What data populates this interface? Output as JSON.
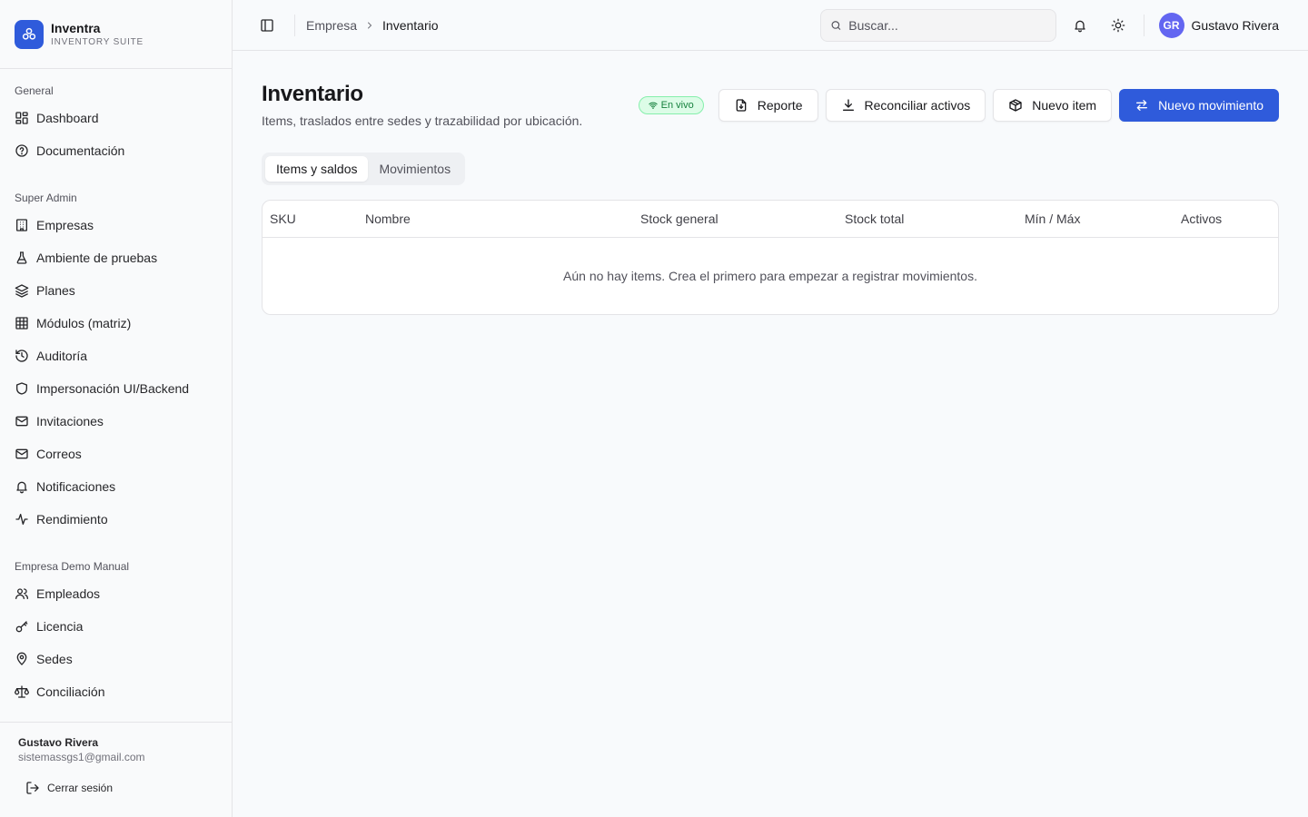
{
  "brand": {
    "name": "Inventra",
    "subtitle": "INVENTORY SUITE"
  },
  "sidebar": {
    "groups": [
      {
        "label": "General",
        "items": [
          {
            "label": "Dashboard",
            "icon": "dashboard-icon"
          },
          {
            "label": "Documentación",
            "icon": "help-circle-icon"
          }
        ]
      },
      {
        "label": "Super Admin",
        "items": [
          {
            "label": "Empresas",
            "icon": "building-icon"
          },
          {
            "label": "Ambiente de pruebas",
            "icon": "flask-icon"
          },
          {
            "label": "Planes",
            "icon": "layers-icon"
          },
          {
            "label": "Módulos (matriz)",
            "icon": "grid-icon"
          },
          {
            "label": "Auditoría",
            "icon": "history-icon"
          },
          {
            "label": "Impersonación UI/Backend",
            "icon": "shield-icon"
          },
          {
            "label": "Invitaciones",
            "icon": "mail-icon"
          },
          {
            "label": "Correos",
            "icon": "mail-icon"
          },
          {
            "label": "Notificaciones",
            "icon": "bell-icon"
          },
          {
            "label": "Rendimiento",
            "icon": "activity-icon"
          }
        ]
      },
      {
        "label": "Empresa Demo Manual",
        "items": [
          {
            "label": "Empleados",
            "icon": "users-icon"
          },
          {
            "label": "Licencia",
            "icon": "key-icon"
          },
          {
            "label": "Sedes",
            "icon": "map-pin-icon"
          },
          {
            "label": "Conciliación",
            "icon": "scale-icon"
          }
        ]
      }
    ],
    "footer": {
      "name": "Gustavo Rivera",
      "email": "sistemassgs1@gmail.com",
      "logout": "Cerrar sesión"
    }
  },
  "topbar": {
    "breadcrumb": {
      "parent": "Empresa",
      "current": "Inventario"
    },
    "search_placeholder": "Buscar...",
    "user": {
      "initials": "GR",
      "name": "Gustavo Rivera"
    }
  },
  "page": {
    "title": "Inventario",
    "subtitle": "Items, traslados entre sedes y trazabilidad por ubicación.",
    "live_badge": "En vivo",
    "buttons": {
      "report": "Reporte",
      "reconcile": "Reconciliar activos",
      "new_item": "Nuevo item",
      "new_movement": "Nuevo movimiento"
    },
    "tabs": [
      {
        "label": "Items y saldos",
        "active": true
      },
      {
        "label": "Movimientos",
        "active": false
      }
    ],
    "table": {
      "columns": [
        "SKU",
        "Nombre",
        "Stock general",
        "Stock total",
        "Mín / Máx",
        "Activos"
      ],
      "empty_message": "Aún no hay items. Crea el primero para empezar a registrar movimientos."
    }
  },
  "colors": {
    "accent": "#2f5bdb",
    "avatar": "#6366f1",
    "live": "#15803d"
  }
}
